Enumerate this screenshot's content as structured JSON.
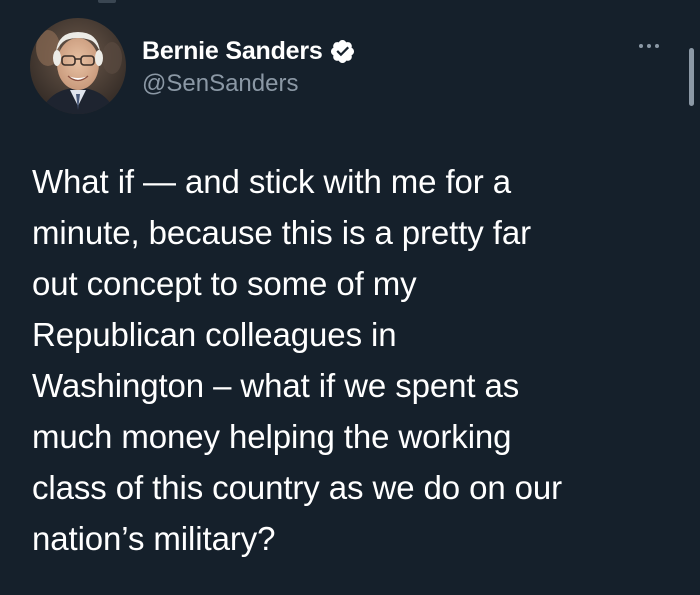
{
  "tweet": {
    "author": {
      "display_name": "Bernie Sanders",
      "handle": "@SenSanders",
      "verified": true,
      "verified_icon": "verified-badge-icon",
      "avatar_icon": "profile-photo"
    },
    "more_icon": "more-options-icon",
    "text_lines": [
      "What if — and stick with me for a",
      "minute, because this is a pretty far",
      "out concept to some of my",
      "Republican colleagues in",
      "Washington – what if we spent as",
      "much money helping the working",
      "class of this country as we do on our",
      "nation’s military?"
    ]
  },
  "colors": {
    "background": "#15202b",
    "text_primary": "#ffffff",
    "text_secondary": "#8b98a5"
  }
}
